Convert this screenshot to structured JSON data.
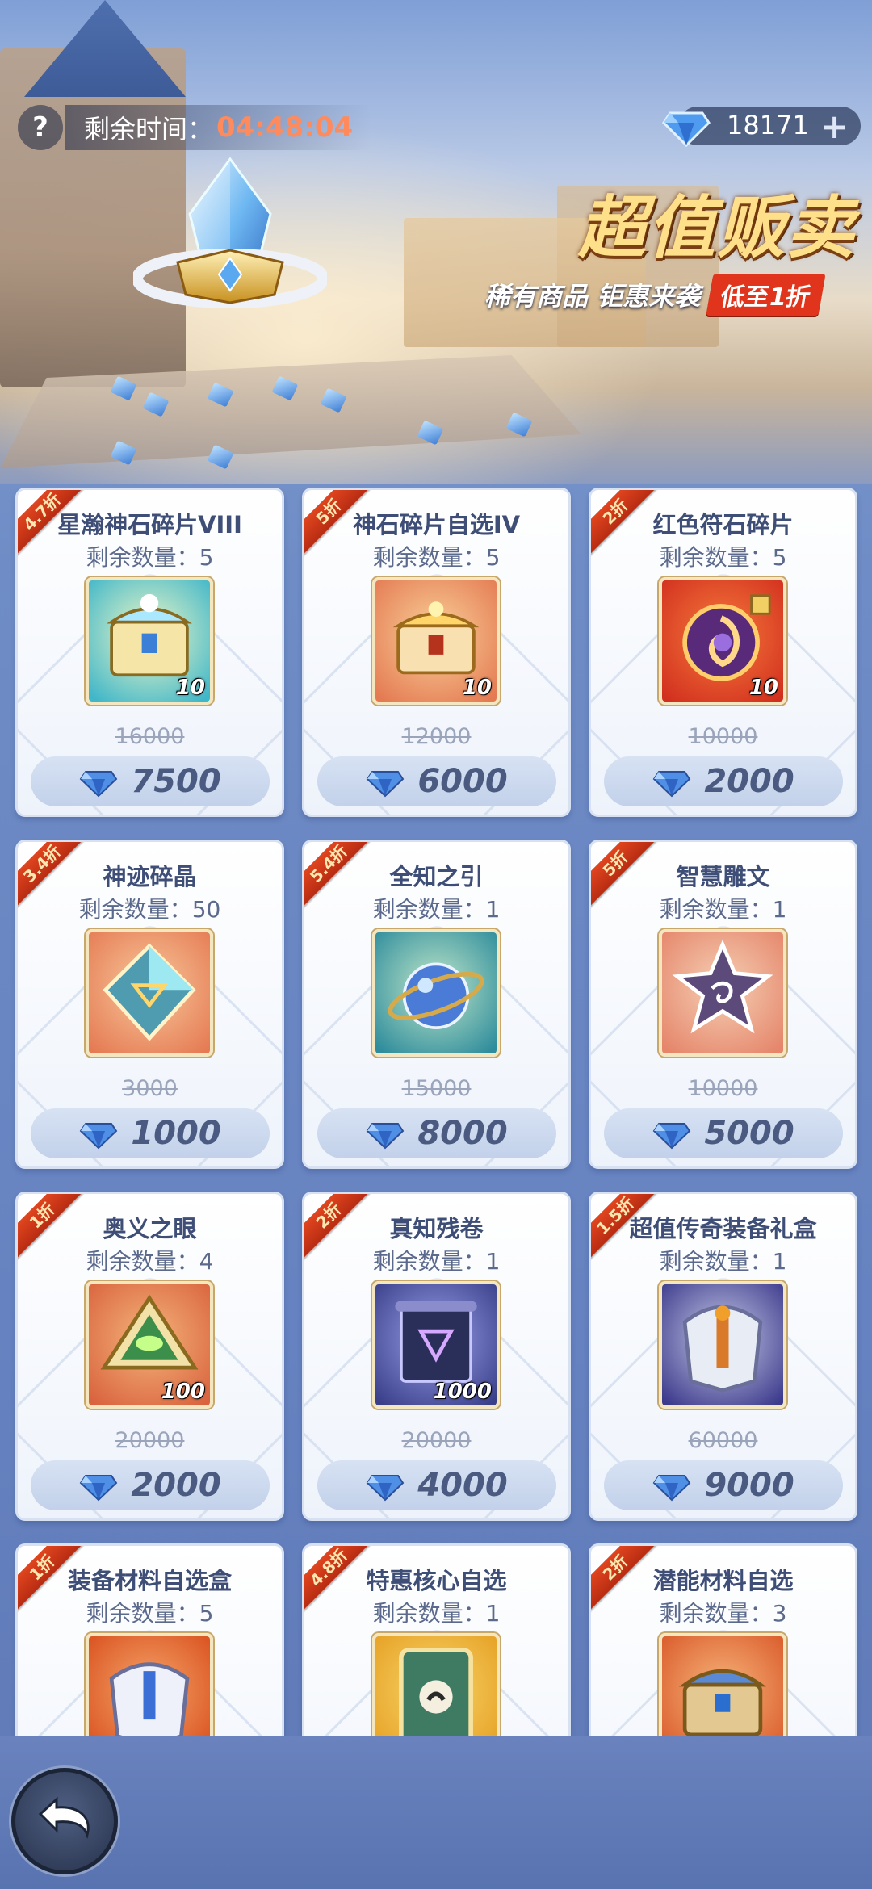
{
  "header": {
    "help_symbol": "?",
    "timer_label": "剩余时间：",
    "timer_value": "04:48:04",
    "currency_value": "18171",
    "currency_plus": "+"
  },
  "banner": {
    "title": "超值贩卖",
    "subtitle": "稀有商品 钜惠来袭",
    "badge": "低至1折"
  },
  "colors": {
    "discount_red": "#e0451f",
    "timer_orange": "#ff8a5c",
    "title_gold": "#ffe08a",
    "price_text": "#4a5a80"
  },
  "items": [
    {
      "discount": "4.7折",
      "name": "星瀚神石碎片VIII",
      "remain_label": "剩余数量：",
      "remain": "5",
      "icon": "rainbow-chest-icon",
      "qty": "10",
      "original_price": "16000",
      "price": "7500"
    },
    {
      "discount": "5折",
      "name": "神石碎片自选IV",
      "remain_label": "剩余数量：",
      "remain": "5",
      "icon": "gold-chest-icon",
      "qty": "10",
      "original_price": "12000",
      "price": "6000"
    },
    {
      "discount": "2折",
      "name": "红色符石碎片",
      "remain_label": "剩余数量：",
      "remain": "5",
      "icon": "red-rune-icon",
      "qty": "10",
      "original_price": "10000",
      "price": "2000"
    },
    {
      "discount": "3.4折",
      "name": "神迹碎晶",
      "remain_label": "剩余数量：",
      "remain": "50",
      "icon": "crystal-shard-icon",
      "qty": "",
      "original_price": "3000",
      "price": "1000"
    },
    {
      "discount": "5.4折",
      "name": "全知之引",
      "remain_label": "剩余数量：",
      "remain": "1",
      "icon": "orb-icon",
      "qty": "",
      "original_price": "15000",
      "price": "8000"
    },
    {
      "discount": "5折",
      "name": "智慧雕文",
      "remain_label": "剩余数量：",
      "remain": "1",
      "icon": "glyph-star-icon",
      "qty": "",
      "original_price": "10000",
      "price": "5000"
    },
    {
      "discount": "1折",
      "name": "奥义之眼",
      "remain_label": "剩余数量：",
      "remain": "4",
      "icon": "eye-prism-icon",
      "qty": "100",
      "original_price": "20000",
      "price": "2000"
    },
    {
      "discount": "2折",
      "name": "真知残卷",
      "remain_label": "剩余数量：",
      "remain": "1",
      "icon": "scroll-icon",
      "qty": "1000",
      "original_price": "20000",
      "price": "4000"
    },
    {
      "discount": "1.5折",
      "name": "超值传奇装备礼盒",
      "remain_label": "剩余数量：",
      "remain": "1",
      "icon": "armor-box-icon",
      "qty": "",
      "original_price": "60000",
      "price": "9000"
    },
    {
      "discount": "1折",
      "name": "装备材料自选盒",
      "remain_label": "剩余数量：",
      "remain": "5",
      "icon": "armor-material-icon",
      "qty": "",
      "original_price": "",
      "price": ""
    },
    {
      "discount": "4.8折",
      "name": "特惠核心自选",
      "remain_label": "剩余数量：",
      "remain": "1",
      "icon": "core-card-icon",
      "qty": "",
      "original_price": "",
      "price": ""
    },
    {
      "discount": "2折",
      "name": "潜能材料自选",
      "remain_label": "剩余数量：",
      "remain": "3",
      "icon": "potential-chest-icon",
      "qty": "",
      "original_price": "",
      "price": ""
    }
  ]
}
